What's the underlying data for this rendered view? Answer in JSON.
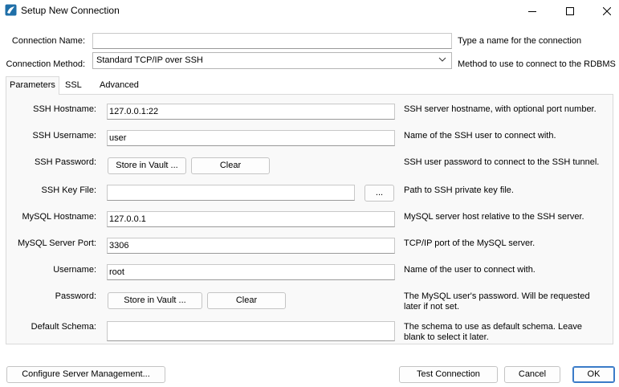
{
  "window": {
    "title": "Setup New Connection"
  },
  "header": {
    "connection_name_label": "Connection Name:",
    "connection_name_value": "",
    "connection_name_help": "Type a name for the connection",
    "connection_method_label": "Connection Method:",
    "connection_method_value": "Standard TCP/IP over SSH",
    "connection_method_help": "Method to use to connect to the RDBMS"
  },
  "tabs": [
    {
      "label": "Parameters",
      "active": true
    },
    {
      "label": "SSL",
      "active": false
    },
    {
      "label": "Advanced",
      "active": false
    }
  ],
  "params": {
    "ssh_hostname_label": "SSH Hostname:",
    "ssh_hostname_value": "127.0.0.1:22",
    "ssh_hostname_help": "SSH server hostname, with  optional port number.",
    "ssh_username_label": "SSH Username:",
    "ssh_username_value": "user",
    "ssh_username_help": "Name of the SSH user to connect with.",
    "ssh_password_label": "SSH Password:",
    "ssh_store_vault": "Store in Vault ...",
    "ssh_clear": "Clear",
    "ssh_password_help": "SSH user password to connect to the SSH tunnel.",
    "ssh_keyfile_label": "SSH Key File:",
    "ssh_keyfile_value": "",
    "browse_label": "...",
    "ssh_keyfile_help": "Path to SSH private key file.",
    "mysql_hostname_label": "MySQL Hostname:",
    "mysql_hostname_value": "127.0.0.1",
    "mysql_hostname_help": "MySQL server host relative to the SSH server.",
    "mysql_port_label": "MySQL Server Port:",
    "mysql_port_value": "3306",
    "mysql_port_help": "TCP/IP port of the MySQL server.",
    "username_label": "Username:",
    "username_value": "root",
    "username_help": "Name of the user to connect with.",
    "password_label": "Password:",
    "store_vault": "Store in Vault ...",
    "clear": "Clear",
    "password_help_1": "The MySQL user's password. Will be requested",
    "password_help_2": "later if not set.",
    "default_schema_label": "Default Schema:",
    "default_schema_value": "",
    "default_schema_help_1": "The schema to use as default schema. Leave",
    "default_schema_help_2": "blank to select it later."
  },
  "footer": {
    "configure": "Configure Server Management...",
    "test": "Test Connection",
    "cancel": "Cancel",
    "ok": "OK"
  },
  "icons": {
    "app": "mysql-workbench-icon",
    "minimize": "minimize-icon",
    "maximize": "maximize-icon",
    "close": "close-icon",
    "dropdown": "chevron-down-icon"
  }
}
